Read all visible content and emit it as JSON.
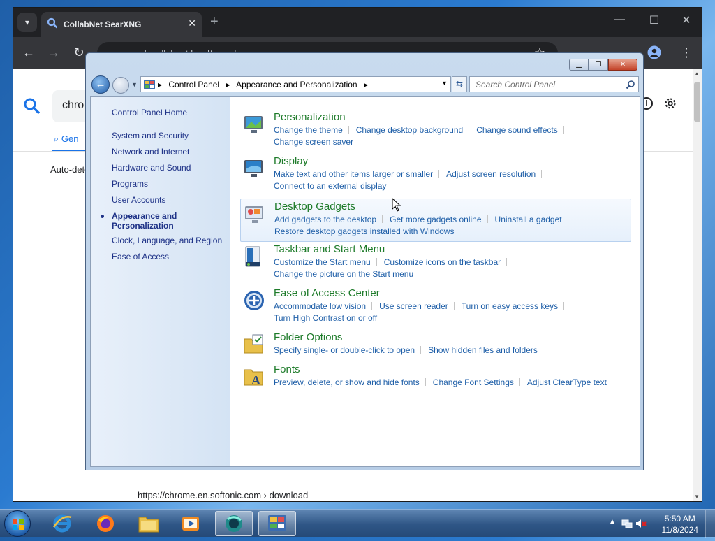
{
  "browser": {
    "tab_title": "CollabNet SearXNG",
    "url": "search.collabnet.local/search",
    "search_query": "chro",
    "search_tab_label": "Gen",
    "autodetect_text": "Auto-dete",
    "result_url": "https://chrome.en.softonic.com › download"
  },
  "control_panel": {
    "breadcrumb": [
      "Control Panel",
      "Appearance and Personalization"
    ],
    "search_placeholder": "Search Control Panel",
    "sidebar": {
      "home": "Control Panel Home",
      "items": [
        "System and Security",
        "Network and Internet",
        "Hardware and Sound",
        "Programs",
        "User Accounts",
        "Appearance and Personalization",
        "Clock, Language, and Region",
        "Ease of Access"
      ],
      "current_line1": "Appearance and",
      "current_line2": "Personalization"
    },
    "categories": [
      {
        "title": "Personalization",
        "icon": "personalization-icon",
        "links": [
          "Change the theme",
          "Change desktop background",
          "Change sound effects",
          "Change screen saver"
        ]
      },
      {
        "title": "Display",
        "icon": "display-icon",
        "links": [
          "Make text and other items larger or smaller",
          "Adjust screen resolution",
          "Connect to an external display"
        ]
      },
      {
        "title": "Desktop Gadgets",
        "icon": "gadgets-icon",
        "links": [
          "Add gadgets to the desktop",
          "Get more gadgets online",
          "Uninstall a gadget",
          "Restore desktop gadgets installed with Windows"
        ]
      },
      {
        "title": "Taskbar and Start Menu",
        "icon": "taskbar-icon",
        "links": [
          "Customize the Start menu",
          "Customize icons on the taskbar",
          "Change the picture on the Start menu"
        ]
      },
      {
        "title": "Ease of Access Center",
        "icon": "ease-of-access-icon",
        "links": [
          "Accommodate low vision",
          "Use screen reader",
          "Turn on easy access keys",
          "Turn High Contrast on or off"
        ]
      },
      {
        "title": "Folder Options",
        "icon": "folder-options-icon",
        "links": [
          "Specify single- or double-click to open",
          "Show hidden files and folders"
        ]
      },
      {
        "title": "Fonts",
        "icon": "fonts-icon",
        "links": [
          "Preview, delete, or show and hide fonts",
          "Change Font Settings",
          "Adjust ClearType text"
        ]
      }
    ]
  },
  "taskbar": {
    "time": "5:50 AM",
    "date": "11/8/2024"
  }
}
